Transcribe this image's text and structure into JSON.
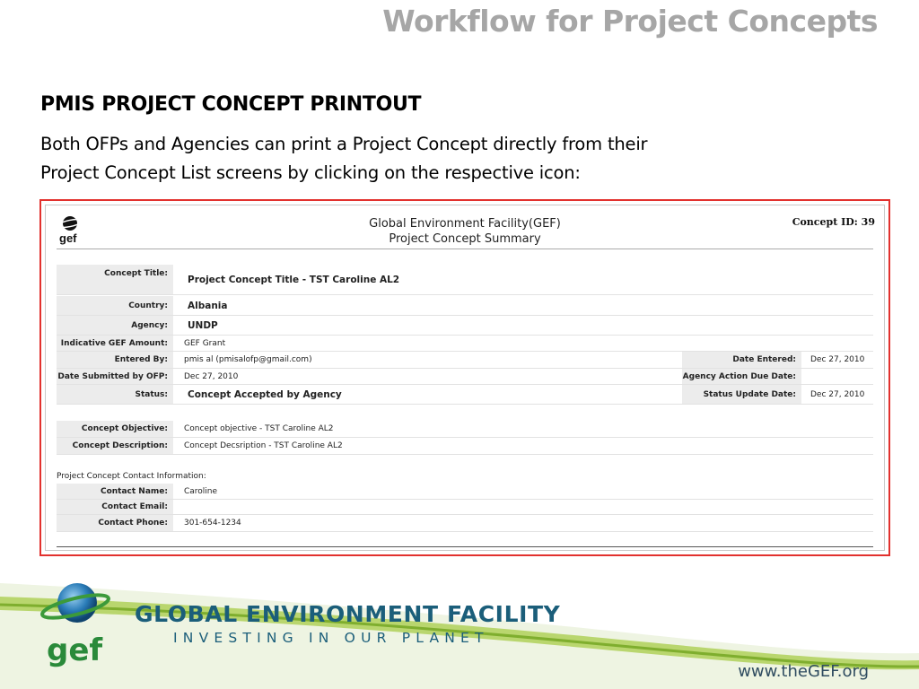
{
  "slide": {
    "title": "Workflow for Project Concepts",
    "heading": "PMIS PROJECT CONCEPT PRINTOUT",
    "body_line1": "Both OFPs and Agencies can print a Project Concept directly from their",
    "body_line2": "Project Concept List screens by clicking on the respective icon:"
  },
  "printout": {
    "logo_text": "gef",
    "title_line1": "Global Environment Facility(GEF)",
    "title_line2": "Project Concept Summary",
    "concept_id": "Concept ID: 39",
    "fields": {
      "concept_title_label": "Concept Title:",
      "concept_title_value": "Project Concept Title - TST Caroline AL2",
      "country_label": "Country:",
      "country_value": "Albania",
      "agency_label": "Agency:",
      "agency_value": "UNDP",
      "amount_label": "Indicative GEF Amount:",
      "amount_value": "GEF Grant",
      "entered_by_label": "Entered By:",
      "entered_by_value": "pmis al (pmisalofp@gmail.com)",
      "date_entered_label": "Date Entered:",
      "date_entered_value": "Dec 27, 2010",
      "date_submitted_label": "Date Submitted by OFP:",
      "date_submitted_value": "Dec 27, 2010",
      "agency_due_label": "Agency Action Due Date:",
      "agency_due_value": "",
      "status_label": "Status:",
      "status_value": "Concept Accepted by Agency",
      "status_update_label": "Status Update Date:",
      "status_update_value": "Dec 27, 2010",
      "objective_label": "Concept Objective:",
      "objective_value": "Concept objective - TST Caroline AL2",
      "description_label": "Concept Description:",
      "description_value": "Concept Decsription - TST Caroline AL2"
    },
    "contact": {
      "heading": "Project Concept Contact Information:",
      "name_label": "Contact Name:",
      "name_value": "Caroline",
      "email_label": "Contact Email:",
      "email_value": "",
      "phone_label": "Contact Phone:",
      "phone_value": "301-654-1234"
    }
  },
  "footer": {
    "logo_text": "gef",
    "org_name": "GLOBAL ENVIRONMENT FACILITY",
    "tagline": "INVESTING IN OUR PLANET",
    "website": "www.theGEF.org"
  },
  "colors": {
    "title_gray": "#a6a6a6",
    "frame_red": "#e2312e",
    "label_bg": "#ececec",
    "brand_blue": "#1b5e7a",
    "swoosh_green": "#9fc54a"
  }
}
